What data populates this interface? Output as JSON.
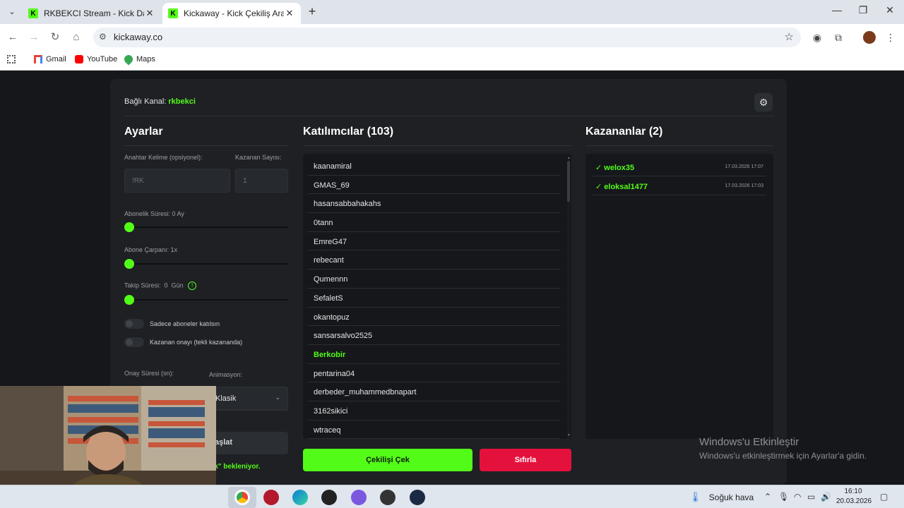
{
  "browser": {
    "tabs": [
      {
        "title": "RKBEKCI Stream - Kick Dashboard",
        "active": false
      },
      {
        "title": "Kickaway - Kick Çekiliş Aracı",
        "active": true
      }
    ],
    "url": "kickaway.co",
    "bookmarks": [
      "Gmail",
      "YouTube",
      "Maps"
    ]
  },
  "app": {
    "channel_label": "Bağlı Kanal:",
    "channel_name": "rkbekci",
    "settings": {
      "title": "Ayarlar",
      "keyword_label": "Anahtar Kelime (opsiyonel):",
      "keyword_placeholder": "!RK",
      "winner_count_label": "Kazanan Sayısı:",
      "winner_count_placeholder": "1",
      "sub_duration_label": "Abonelik Süresi: 0 Ay",
      "sub_multiplier_label": "Abone Çarpanı: 1x",
      "follow_label": "Takip Süresi:",
      "follow_value": "0",
      "follow_unit": "Gün",
      "toggle_subs_only": "Sadece aboneler katılsın",
      "toggle_winner_confirm": "Kazanan onayı (tekli kazananda)",
      "confirm_time_label": "Onay Süresi (sn):",
      "animation_label": "Animasyon:",
      "animation_value": "Klasik",
      "start_button": "aşlat",
      "waiting_text": "!rk\" bekleniyor."
    },
    "participants": {
      "title": "Katılımcılar (103)",
      "names": [
        "kaanamiral",
        "GMAS_69",
        "hasansabbahakahs",
        "0tann",
        "EmreG47",
        "rebecant",
        "Qumennn",
        "SefaletS",
        "okantopuz",
        "sansarsalvo2525",
        "Berkobir",
        "pentarina04",
        "derbeder_muhammedbnapart",
        "3162sikici",
        "wtraceq"
      ],
      "highlighted_index": 10,
      "draw_button": "Çekilişi Çek",
      "reset_button": "Sıfırla"
    },
    "winners": {
      "title": "Kazananlar (2)",
      "items": [
        {
          "name": "welox35",
          "time": "17.03.2026 17:07"
        },
        {
          "name": "eloksal1477",
          "time": "17.03.2026 17:03"
        }
      ]
    }
  },
  "watermark": {
    "line1": "Windows'u Etkinleştir",
    "line2": "Windows'u etkinleştirmek için Ayarlar'a gidin."
  },
  "taskbar": {
    "weather": "Soğuk hava",
    "time": "16:10",
    "date": "20.03.2026"
  },
  "colors": {
    "accent": "#53fc18",
    "danger": "#e5113d",
    "panel": "#1e2024",
    "background": "#15171b"
  }
}
